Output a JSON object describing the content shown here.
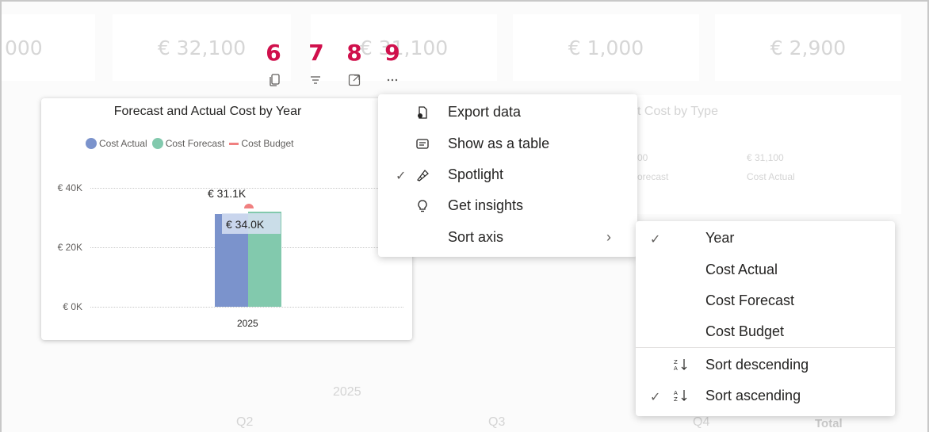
{
  "kpis": [
    "000",
    "€ 32,100",
    "€ 31,100",
    "€ 1,000",
    "€ 2,900"
  ],
  "step_numbers": [
    "6",
    "7",
    "8",
    "9"
  ],
  "toolbar_icons": [
    "copy-icon",
    "filter-icon",
    "focus-mode-icon",
    "more-options-icon"
  ],
  "visual": {
    "title": "Forecast and Actual Cost by Year",
    "legend": [
      {
        "name": "Cost Actual",
        "color": "#7b93cc",
        "marker": "dot"
      },
      {
        "name": "Cost Forecast",
        "color": "#82c9ad",
        "marker": "dot"
      },
      {
        "name": "Cost Budget",
        "color": "#f08080",
        "marker": "line"
      }
    ],
    "y_ticks": [
      "€ 40K",
      "€ 20K",
      "€ 0K"
    ],
    "data_labels": {
      "budget": "€ 31.1K",
      "forecast": "€ 34.0K"
    }
  },
  "chart_data": {
    "type": "bar",
    "title": "Forecast and Actual Cost by Year",
    "categories": [
      "2025"
    ],
    "series": [
      {
        "name": "Cost Actual",
        "values": [
          31100
        ]
      },
      {
        "name": "Cost Forecast",
        "values": [
          32100
        ]
      },
      {
        "name": "Cost Budget",
        "values": [
          34000
        ]
      }
    ],
    "ylim": [
      0,
      40000
    ],
    "legend": "top"
  },
  "menu": {
    "items": [
      {
        "label": "Export data",
        "icon": "export-icon",
        "checked": false
      },
      {
        "label": "Show as a table",
        "icon": "table-icon",
        "checked": false
      },
      {
        "label": "Spotlight",
        "icon": "spotlight-icon",
        "checked": true
      },
      {
        "label": "Get insights",
        "icon": "lightbulb-icon",
        "checked": false
      },
      {
        "label": "Sort axis",
        "icon": "",
        "checked": false,
        "submenu": true
      }
    ]
  },
  "submenu": {
    "items": [
      {
        "label": "Year",
        "checked": true
      },
      {
        "label": "Cost Actual",
        "checked": false
      },
      {
        "label": "Cost Forecast",
        "checked": false
      },
      {
        "label": "Cost Budget",
        "checked": false
      }
    ],
    "sort_items": [
      {
        "label": "Sort descending",
        "icon": "sort-descending-icon",
        "checked": false
      },
      {
        "label": "Sort ascending",
        "icon": "sort-ascending-icon",
        "checked": true
      }
    ]
  },
  "background": {
    "title_fragment": "t Cost by Type",
    "val1": "00",
    "lab1": "orecast",
    "val2": "€ 31,100",
    "lab2": "Cost Actual",
    "year": "2025",
    "quarters": [
      "Q2",
      "Q3",
      "Q4"
    ],
    "total": "Total"
  }
}
